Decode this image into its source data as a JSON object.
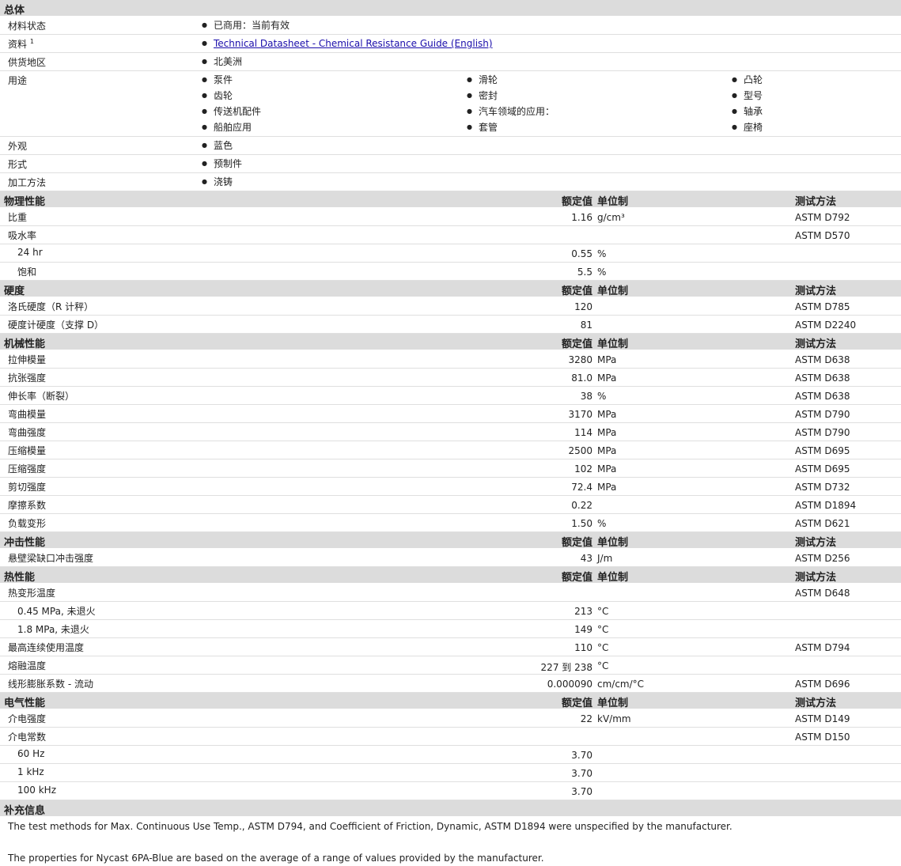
{
  "general": {
    "title": "总体",
    "material_status": {
      "label": "材料状态",
      "items": [
        "已商用：当前有效"
      ]
    },
    "resources": {
      "label": "资料",
      "sup": "1",
      "items": [
        "Technical Datasheet - Chemical Resistance Guide (English)"
      ]
    },
    "availability": {
      "label": "供货地区",
      "items": [
        "北美洲"
      ]
    },
    "uses": {
      "label": "用途",
      "col1": [
        "泵件",
        "齿轮",
        "传送机配件",
        "船舶应用"
      ],
      "col2": [
        "滑轮",
        "密封",
        "汽车领域的应用：",
        "套管"
      ],
      "col3": [
        "凸轮",
        "型号",
        "轴承",
        "座椅"
      ]
    },
    "appearance": {
      "label": "外观",
      "items": [
        "蓝色"
      ]
    },
    "forms": {
      "label": "形式",
      "items": [
        "预制件"
      ]
    },
    "processing": {
      "label": "加工方法",
      "items": [
        "浇铸"
      ]
    }
  },
  "headers": {
    "nominal": "额定值",
    "unit": "单位制",
    "method": "测试方法"
  },
  "physical": {
    "title": "物理性能",
    "rows": [
      {
        "label": "比重",
        "value": "1.16",
        "unit": "g/cm³",
        "method": "ASTM D792"
      },
      {
        "label": "吸水率",
        "value": "",
        "unit": "",
        "method": "ASTM D570"
      },
      {
        "label": "24 hr",
        "value": "0.55",
        "unit": "%",
        "method": "",
        "sub": true
      },
      {
        "label": "饱和",
        "value": "5.5",
        "unit": "%",
        "method": "",
        "sub": true
      }
    ]
  },
  "hardness": {
    "title": "硬度",
    "rows": [
      {
        "label": "洛氏硬度（R 计秤）",
        "value": "120",
        "unit": "",
        "method": "ASTM D785"
      },
      {
        "label": "硬度计硬度（支撑 D）",
        "value": "81",
        "unit": "",
        "method": "ASTM D2240"
      }
    ]
  },
  "mechanical": {
    "title": "机械性能",
    "rows": [
      {
        "label": "拉伸模量",
        "value": "3280",
        "unit": "MPa",
        "method": "ASTM D638"
      },
      {
        "label": "抗张强度",
        "value": "81.0",
        "unit": "MPa",
        "method": "ASTM D638"
      },
      {
        "label": "伸长率（断裂）",
        "value": "38",
        "unit": "%",
        "method": "ASTM D638"
      },
      {
        "label": "弯曲模量",
        "value": "3170",
        "unit": "MPa",
        "method": "ASTM D790"
      },
      {
        "label": "弯曲强度",
        "value": "114",
        "unit": "MPa",
        "method": "ASTM D790"
      },
      {
        "label": "压缩模量",
        "value": "2500",
        "unit": "MPa",
        "method": "ASTM D695"
      },
      {
        "label": "压缩强度",
        "value": "102",
        "unit": "MPa",
        "method": "ASTM D695"
      },
      {
        "label": "剪切强度",
        "value": "72.4",
        "unit": "MPa",
        "method": "ASTM D732"
      },
      {
        "label": "摩擦系数",
        "value": "0.22",
        "unit": "",
        "method": "ASTM D1894"
      },
      {
        "label": "负载变形",
        "value": "1.50",
        "unit": "%",
        "method": "ASTM D621"
      }
    ]
  },
  "impact": {
    "title": "冲击性能",
    "rows": [
      {
        "label": "悬壁梁缺口冲击强度",
        "value": "43",
        "unit": "J/m",
        "method": "ASTM D256"
      }
    ]
  },
  "thermal": {
    "title": "热性能",
    "rows": [
      {
        "label": "热变形温度",
        "value": "",
        "unit": "",
        "method": "ASTM D648"
      },
      {
        "label": "0.45 MPa, 未退火",
        "value": "213",
        "unit": "°C",
        "method": "",
        "sub": true
      },
      {
        "label": "1.8 MPa, 未退火",
        "value": "149",
        "unit": "°C",
        "method": "",
        "sub": true
      },
      {
        "label": "最高连续使用温度",
        "value": "110",
        "unit": "°C",
        "method": "ASTM D794"
      },
      {
        "label": "熔融温度",
        "value": "227 到  238",
        "unit": "°C",
        "method": ""
      },
      {
        "label": "线形膨胀系数  - 流动",
        "value": "0.000090",
        "unit": "cm/cm/°C",
        "method": "ASTM D696"
      }
    ]
  },
  "electrical": {
    "title": "电气性能",
    "rows": [
      {
        "label": "介电强度",
        "value": "22",
        "unit": "kV/mm",
        "method": "ASTM D149"
      },
      {
        "label": "介电常数",
        "value": "",
        "unit": "",
        "method": "ASTM D150"
      },
      {
        "label": "60 Hz",
        "value": "3.70",
        "unit": "",
        "method": "",
        "sub": true
      },
      {
        "label": "1 kHz",
        "value": "3.70",
        "unit": "",
        "method": "",
        "sub": true
      },
      {
        "label": "100 kHz",
        "value": "3.70",
        "unit": "",
        "method": "",
        "sub": true
      }
    ]
  },
  "supplemental": {
    "title": "补充信息",
    "note1": "The test methods for Max. Continuous Use Temp., ASTM D794, and Coefficient of Friction, Dynamic, ASTM D1894 were unspecified by the manufacturer.",
    "note2": "The properties for Nycast 6PA-Blue are based on the average of a range of values provided by the manufacturer."
  }
}
